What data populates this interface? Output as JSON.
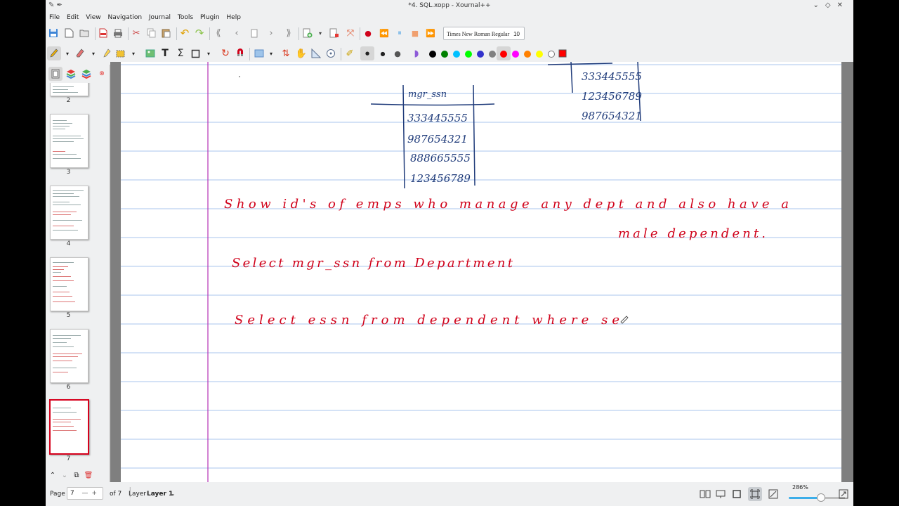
{
  "window": {
    "title": "*4. SQL.xopp - Xournal++"
  },
  "menu": [
    "File",
    "Edit",
    "View",
    "Navigation",
    "Journal",
    "Tools",
    "Plugin",
    "Help"
  ],
  "font_selector": {
    "font_name": "Times New Roman Regular",
    "font_size": "10"
  },
  "colors": {
    "ink": "#d0021b",
    "table_ink": "#1f3b7a",
    "rule_line": "#a9c6ee",
    "margin_line": "#b42fb4",
    "accent": "#3daee9",
    "palette": [
      "#000000",
      "#008000",
      "#00c0ff",
      "#00ff00",
      "#3333cc",
      "#808080",
      "#ff0000",
      "#ff00ff",
      "#ff8000",
      "#ffff00",
      "#ffffff"
    ]
  },
  "sidebar": {
    "pages": [
      {
        "number": "2"
      },
      {
        "number": "3"
      },
      {
        "number": "4"
      },
      {
        "number": "5"
      },
      {
        "number": "6"
      },
      {
        "number": "7",
        "active": true
      }
    ]
  },
  "handwriting": {
    "table1": {
      "header": "mgr_ssn",
      "rows": [
        "333445555",
        "987654321",
        "888665555",
        "123456789"
      ]
    },
    "table2": {
      "rows": [
        "333445555",
        "123456789",
        "987654321"
      ]
    },
    "line1": "Show id's of emps who manage any dept and also have a",
    "line2": "male dependent.",
    "line3": "Select mgr_ssn from Department",
    "line4": "Select essn from dependent where se"
  },
  "status": {
    "page_label": "Page",
    "page_value": "7",
    "of_label": "of 7",
    "layer_label": "Layer",
    "layer_value": "Layer 1",
    "zoom": "286%",
    "zoom_fraction": 0.58
  }
}
